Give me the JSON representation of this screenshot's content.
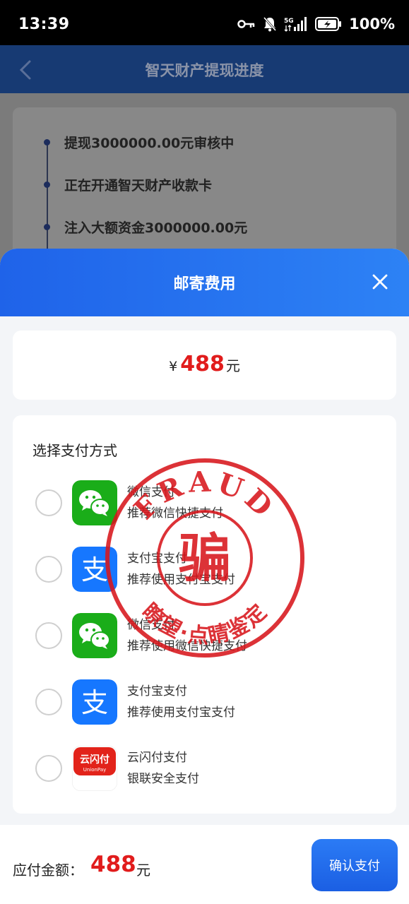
{
  "status_bar": {
    "time": "13:39",
    "network": "5G",
    "battery": "100%"
  },
  "header": {
    "title": "智天财产提现进度"
  },
  "timeline": {
    "items": [
      {
        "text": "提现3000000.00元审核中"
      },
      {
        "text": "正在开通智天财产收款卡"
      },
      {
        "text": "注入大额资金3000000.00元"
      }
    ]
  },
  "sheet": {
    "title": "邮寄费用"
  },
  "amount": {
    "currency": "¥",
    "value": "488",
    "unit": "元"
  },
  "payment": {
    "heading": "选择支付方式",
    "options": [
      {
        "name": "微信支付",
        "desc": "推荐微信快捷支付",
        "icon": "wechat-icon"
      },
      {
        "name": "支付宝支付",
        "desc": "推荐使用支付宝支付",
        "icon": "alipay-icon"
      },
      {
        "name": "微信支付",
        "desc": "推荐使用微信快捷支付",
        "icon": "wechat-icon"
      },
      {
        "name": "支付宝支付",
        "desc": "推荐使用支付宝支付",
        "icon": "alipay-icon"
      },
      {
        "name": "云闪付支付",
        "desc": "银联安全支付",
        "icon": "unionpay-icon"
      }
    ]
  },
  "footer": {
    "label": "应付金额：",
    "amount": "488",
    "unit": "元",
    "confirm_label": "确认支付"
  },
  "stamp": {
    "top_text": "FRAUD",
    "center": "骗",
    "bottom_text": "瞭望·点睛鉴定"
  },
  "colors": {
    "accent_blue": "#1f63e9",
    "price_red": "#e11c1c",
    "wechat_green": "#1aad19",
    "alipay_blue": "#1677ff",
    "stamp_red": "#d8161c"
  }
}
